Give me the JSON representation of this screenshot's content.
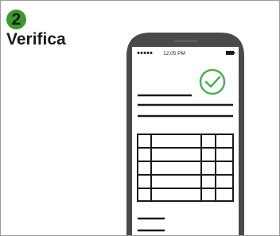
{
  "step": {
    "number": "2",
    "title": "Verifica"
  },
  "phone": {
    "status_bar": {
      "time": "12:05 PM"
    },
    "document": {
      "verified_icon": "checkmark-circle-icon",
      "table_rows": 5,
      "table_columns": 4
    }
  },
  "colors": {
    "badge": "#3a9a2e",
    "accent_green": "#4caf50",
    "phone_body": "#4a4a4a",
    "text": "#1a1a1a"
  }
}
